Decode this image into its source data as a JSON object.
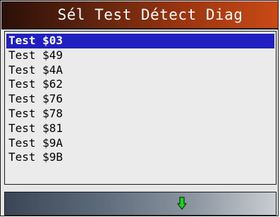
{
  "title": "Sél Test Détect Diag",
  "list": {
    "items": [
      {
        "label": "Test $03",
        "selected": true
      },
      {
        "label": "Test $49",
        "selected": false
      },
      {
        "label": "Test $4A",
        "selected": false
      },
      {
        "label": "Test $62",
        "selected": false
      },
      {
        "label": "Test $76",
        "selected": false
      },
      {
        "label": "Test $78",
        "selected": false
      },
      {
        "label": "Test $81",
        "selected": false
      },
      {
        "label": "Test $9A",
        "selected": false
      },
      {
        "label": "Test $9B",
        "selected": false
      }
    ]
  },
  "footer": {
    "icon": "down-arrow-icon",
    "icon_color": "#20d020"
  },
  "colors": {
    "selection": "#2020c0",
    "title_accent": "#c84a16"
  }
}
